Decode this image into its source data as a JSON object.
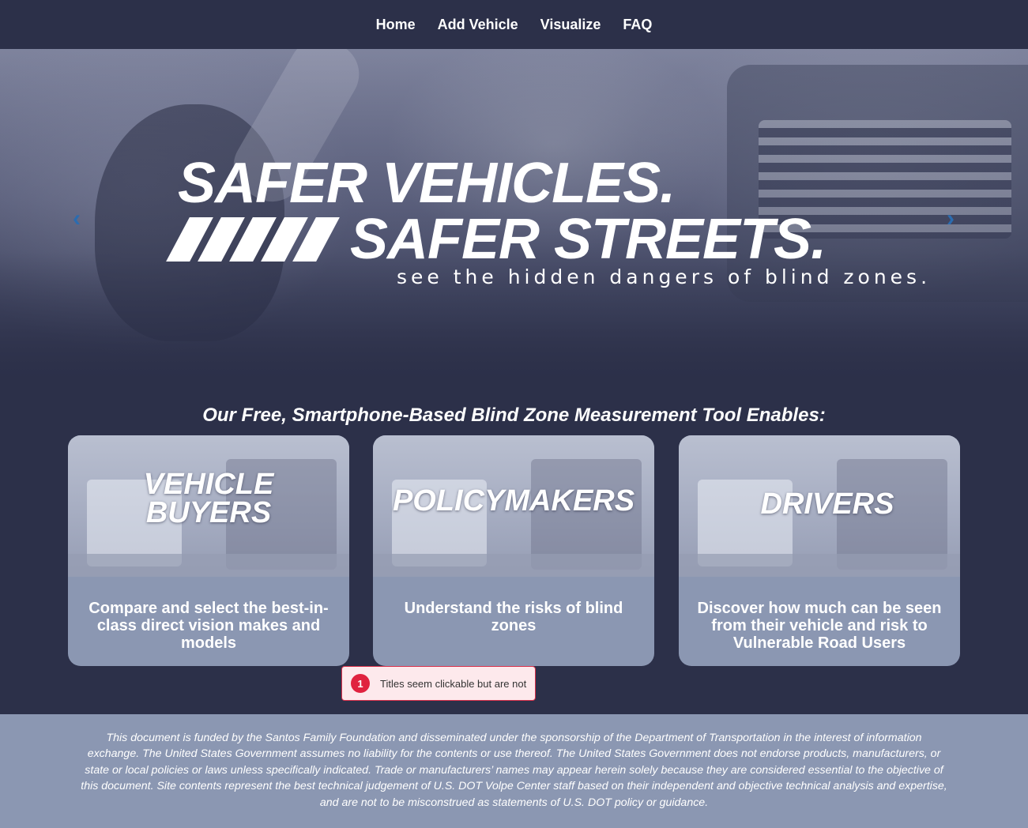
{
  "nav": {
    "items": [
      {
        "label": "Home"
      },
      {
        "label": "Add Vehicle"
      },
      {
        "label": "Visualize"
      },
      {
        "label": "FAQ"
      }
    ]
  },
  "hero": {
    "line1": "SAFER VEHICLES.",
    "line2": "SAFER STREETS.",
    "subtitle": "see the hidden dangers of blind zones.",
    "prev_icon": "chevron-left-icon",
    "next_icon": "chevron-right-icon"
  },
  "section": {
    "title": "Our Free, Smartphone-Based Blind Zone Measurement Tool Enables:"
  },
  "cards": [
    {
      "heading": "VEHICLE BUYERS",
      "description": "Compare and select the best-in-class direct vision makes and models"
    },
    {
      "heading": "POLICYMAKERS",
      "description": "Understand the risks of blind zones"
    },
    {
      "heading": "DRIVERS",
      "description": "Discover how much can be seen from their vehicle and risk to Vulnerable Road Users"
    }
  ],
  "annotation": {
    "number": "1",
    "text": "Titles seem clickable but are not"
  },
  "footer": {
    "text": "This document is funded by the Santos Family Foundation and disseminated under the sponsorship of the Department of Transportation in the interest of information exchange. The United States Government assumes no liability for the contents or use thereof. The United States Government does not endorse products, manufacturers, or state or local policies or laws unless specifically indicated. Trade or manufacturers’ names may appear herein solely because they are considered essential to the objective of this document. Site contents represent the best technical judgement of U.S. DOT Volpe Center staff based on their independent and objective technical analysis and expertise, and are not to be misconstrued as statements of U.S. DOT policy or guidance."
  },
  "colors": {
    "background": "#2c3049",
    "card": "#8b97b2",
    "accent_arrow": "#2b6cb0",
    "annotation_red": "#e0223f"
  }
}
